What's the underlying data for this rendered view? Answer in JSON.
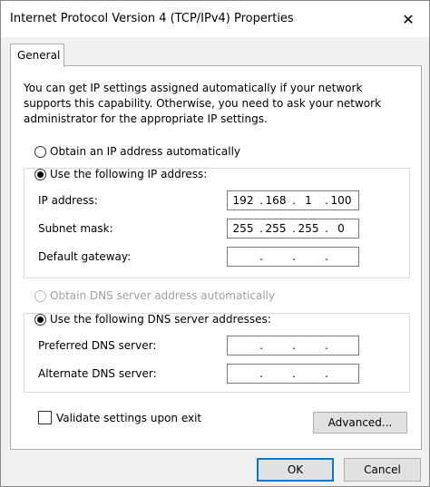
{
  "window": {
    "title": "Internet Protocol Version 4 (TCP/IPv4) Properties",
    "close_glyph": "✕"
  },
  "tabs": [
    {
      "label": "General"
    }
  ],
  "intro_text": "You can get IP settings assigned automatically if your network supports this capability. Otherwise, you need to ask your network administrator for the appropriate IP settings.",
  "ip_section": {
    "auto_label": "Obtain an IP address automatically",
    "manual_label": "Use the following IP address:",
    "selected": "manual",
    "fields": [
      {
        "label": "IP address:",
        "octets": [
          "192",
          "168",
          "1",
          "100"
        ]
      },
      {
        "label": "Subnet mask:",
        "octets": [
          "255",
          "255",
          "255",
          "0"
        ]
      },
      {
        "label": "Default gateway:",
        "octets": [
          "",
          "",
          "",
          ""
        ]
      }
    ]
  },
  "dns_section": {
    "auto_label": "Obtain DNS server address automatically",
    "manual_label": "Use the following DNS server addresses:",
    "selected": "manual",
    "auto_disabled": true,
    "fields": [
      {
        "label": "Preferred DNS server:",
        "octets": [
          "",
          "",
          "",
          ""
        ]
      },
      {
        "label": "Alternate DNS server:",
        "octets": [
          "",
          "",
          "",
          ""
        ]
      }
    ]
  },
  "validate": {
    "label": "Validate settings upon exit",
    "checked": false
  },
  "buttons": {
    "advanced": "Advanced...",
    "ok": "OK",
    "cancel": "Cancel"
  }
}
